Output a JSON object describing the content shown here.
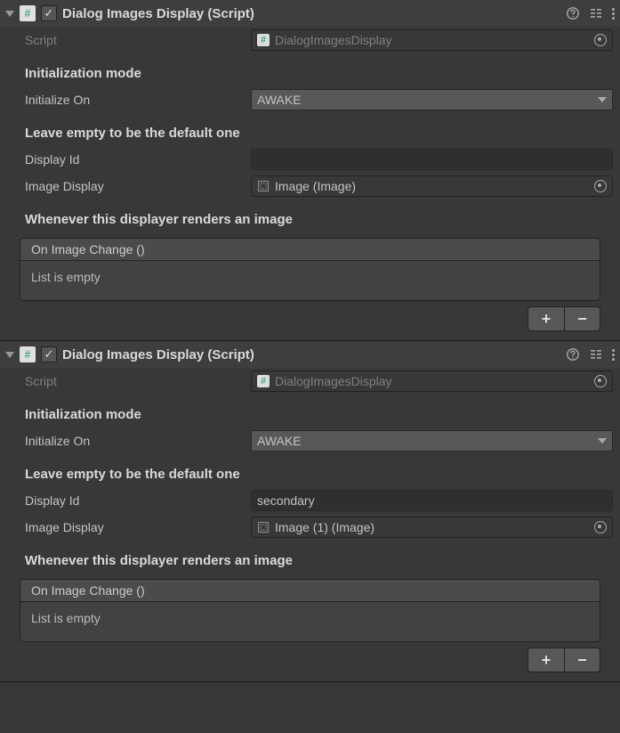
{
  "components": [
    {
      "enabled": true,
      "title": "Dialog Images Display (Script)",
      "script": "DialogImagesDisplay",
      "init_header": "Initialization mode",
      "init_label": "Initialize On",
      "init_value": "AWAKE",
      "display_header": "Leave empty to be the default one",
      "display_id_label": "Display Id",
      "display_id_value": "",
      "image_display_label": "Image Display",
      "image_display_value": "Image (Image)",
      "event_header": "Whenever this displayer renders an image",
      "event_name": "On Image Change ()",
      "event_empty": "List is empty"
    },
    {
      "enabled": true,
      "title": "Dialog Images Display (Script)",
      "script": "DialogImagesDisplay",
      "init_header": "Initialization mode",
      "init_label": "Initialize On",
      "init_value": "AWAKE",
      "display_header": "Leave empty to be the default one",
      "display_id_label": "Display Id",
      "display_id_value": "secondary",
      "image_display_label": "Image Display",
      "image_display_value": "Image (1) (Image)",
      "event_header": "Whenever this displayer renders an image",
      "event_name": "On Image Change ()",
      "event_empty": "List is empty"
    }
  ],
  "labels": {
    "script": "Script",
    "plus": "+",
    "minus": "−"
  }
}
